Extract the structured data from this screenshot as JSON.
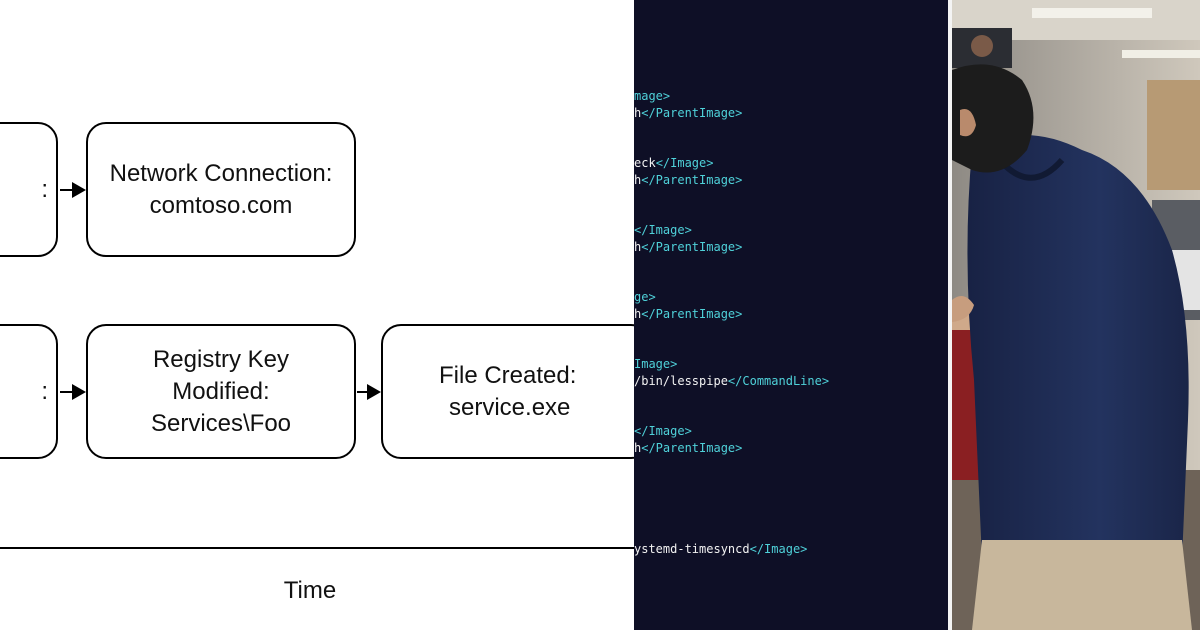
{
  "diagram": {
    "row1": {
      "left_fragment": ":",
      "network_box": [
        "Network Connection:",
        "comtoso.com"
      ]
    },
    "row2": {
      "left_fragment": ":",
      "registry_box": [
        "Registry Key",
        "Modified:",
        "Services\\Foo"
      ],
      "file_box": [
        "File Created:",
        "service.exe"
      ]
    },
    "axis_label": "Time"
  },
  "terminal": {
    "lines": [
      {
        "text": "mage>",
        "close_tag": ""
      },
      {
        "text": "h",
        "close_tag": "</ParentImage>"
      },
      {
        "text": "eck",
        "close_tag": "</Image>"
      },
      {
        "text": "h",
        "close_tag": "</ParentImage>"
      },
      {
        "text": "",
        "close_tag": "</Image>"
      },
      {
        "text": "h",
        "close_tag": "</ParentImage>"
      },
      {
        "text": "ge>",
        "close_tag": ""
      },
      {
        "text": "h",
        "close_tag": "</ParentImage>"
      },
      {
        "text": "Image>",
        "close_tag": ""
      },
      {
        "text": "/bin/lesspipe",
        "close_tag": "</CommandLine>"
      },
      {
        "text": "",
        "close_tag": "</Image>"
      },
      {
        "text": "h",
        "close_tag": "</ParentImage>"
      },
      {
        "text": "ystemd-timesyncd",
        "close_tag": "</Image>"
      }
    ]
  },
  "colors": {
    "terminal_bg": "#0e0f26",
    "tag": "#4fd1d9",
    "text": "#f2f2f2",
    "sweater": "#1f2d55"
  }
}
